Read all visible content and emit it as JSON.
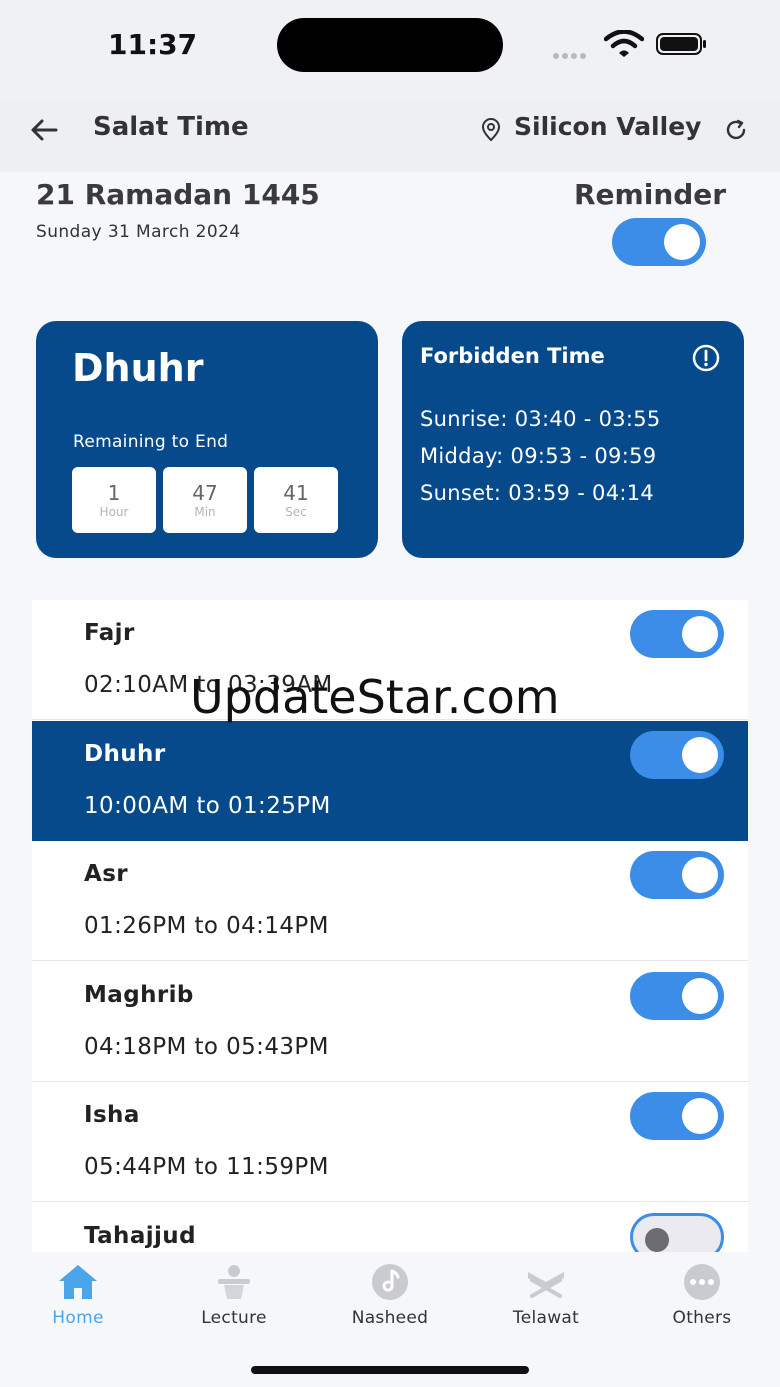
{
  "status_bar": {
    "time": "11:37"
  },
  "nav": {
    "title": "Salat Time",
    "location": "Silicon Valley"
  },
  "header": {
    "hijri_date": "21 Ramadan 1445",
    "gregorian_date": "Sunday 31 March 2024",
    "reminder_label": "Reminder",
    "reminder_on": true
  },
  "current": {
    "prayer": "Dhuhr",
    "remaining_label": "Remaining to End",
    "countdown": [
      {
        "value": "1",
        "unit": "Hour"
      },
      {
        "value": "47",
        "unit": "Min"
      },
      {
        "value": "41",
        "unit": "Sec"
      }
    ]
  },
  "forbidden": {
    "title": "Forbidden Time",
    "lines": [
      "Sunrise: 03:40 - 03:55",
      "Midday: 09:53 - 09:59",
      "Sunset: 03:59 - 04:14"
    ]
  },
  "prayers": [
    {
      "name": "Fajr",
      "range": "02:10AM to 03:39AM",
      "on": true,
      "active": false
    },
    {
      "name": "Dhuhr",
      "range": "10:00AM to 01:25PM",
      "on": true,
      "active": true
    },
    {
      "name": "Asr",
      "range": "01:26PM to 04:14PM",
      "on": true,
      "active": false
    },
    {
      "name": "Maghrib",
      "range": "04:18PM to 05:43PM",
      "on": true,
      "active": false
    },
    {
      "name": "Isha",
      "range": "05:44PM to 11:59PM",
      "on": true,
      "active": false
    },
    {
      "name": "Tahajjud",
      "range": "",
      "on": false,
      "active": false
    }
  ],
  "watermark": "UpdateStar.com",
  "tabs": [
    {
      "label": "Home",
      "icon": "home-icon",
      "active": true
    },
    {
      "label": "Lecture",
      "icon": "lecture-icon",
      "active": false
    },
    {
      "label": "Nasheed",
      "icon": "music-icon",
      "active": false
    },
    {
      "label": "Telawat",
      "icon": "quran-stand-icon",
      "active": false
    },
    {
      "label": "Others",
      "icon": "more-icon",
      "active": false
    }
  ],
  "colors": {
    "primary": "#064a8b",
    "toggle": "#3b8de8",
    "tab_active": "#4aa6e8"
  }
}
